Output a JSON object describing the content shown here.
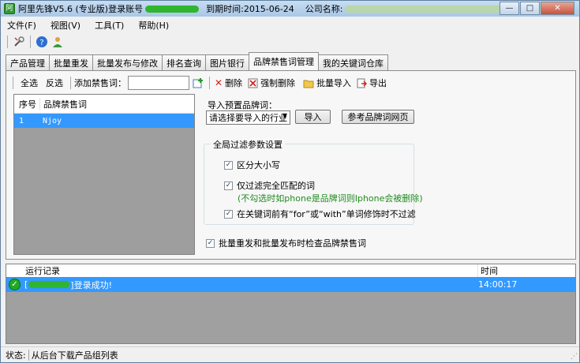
{
  "title": {
    "app_name": "阿里先锋V5.6 (专业版)登录账号",
    "expiry": "到期时间:2015-06-24",
    "company": "公司名称:",
    "minimize": "—",
    "maximize": "□",
    "close": "✕"
  },
  "menu": [
    "文件(F)",
    "视图(V)",
    "工具(T)",
    "帮助(H)"
  ],
  "tabs": [
    "产品管理",
    "批量重发",
    "批量发布与修改",
    "排名查询",
    "图片银行",
    "品牌禁售词管理",
    "我的关键词仓库"
  ],
  "active_tab": "品牌禁售词管理",
  "panel_toolbar": {
    "select_all": "全选",
    "invert": "反选",
    "add_label": "添加禁售词：",
    "add_value": "",
    "delete": "删除",
    "force_delete": "强制删除",
    "batch_import": "批量导入",
    "export": "导出"
  },
  "list": {
    "headers": [
      "序号",
      "品牌禁售词"
    ],
    "rows": [
      [
        "1",
        "Njoy"
      ]
    ]
  },
  "import": {
    "label": "导入预置品牌词：",
    "select_value": "请选择要导入的行业",
    "import_button": "导入",
    "reference_button": "参考品牌词网页"
  },
  "global_filter": {
    "title": "全局过滤参数设置",
    "case_sensitive": "区分大小写",
    "exact_match": "仅过滤完全匹配的词",
    "exact_hint": "(不勾选时如phone是品牌词则Iphone会被删除)",
    "ignore_for_with": "在关键词前有“for”或“with”单词修饰时不过滤",
    "case_checked": true,
    "exact_checked": true,
    "ignore_checked": true
  },
  "check_on_publish": {
    "label": "批量重发和批量发布时检查品牌禁售词",
    "checked": true
  },
  "log": {
    "headers": [
      "运行记录",
      "时间"
    ],
    "rows": [
      {
        "prefix": "[",
        "suffix": "]登录成功!",
        "time": "14:00:17"
      }
    ]
  },
  "status": {
    "label": "状态:",
    "text": "从后台下载产品组列表"
  },
  "icons": {
    "toolbar": [
      "settings-tools-icon",
      "help-icon",
      "user-icon"
    ],
    "delete": "red-x-icon",
    "force_delete": "force-delete-icon",
    "batch_import": "folder-icon",
    "export": "export-icon",
    "add": "add-word-icon",
    "log_ok": "check-circle-icon"
  }
}
